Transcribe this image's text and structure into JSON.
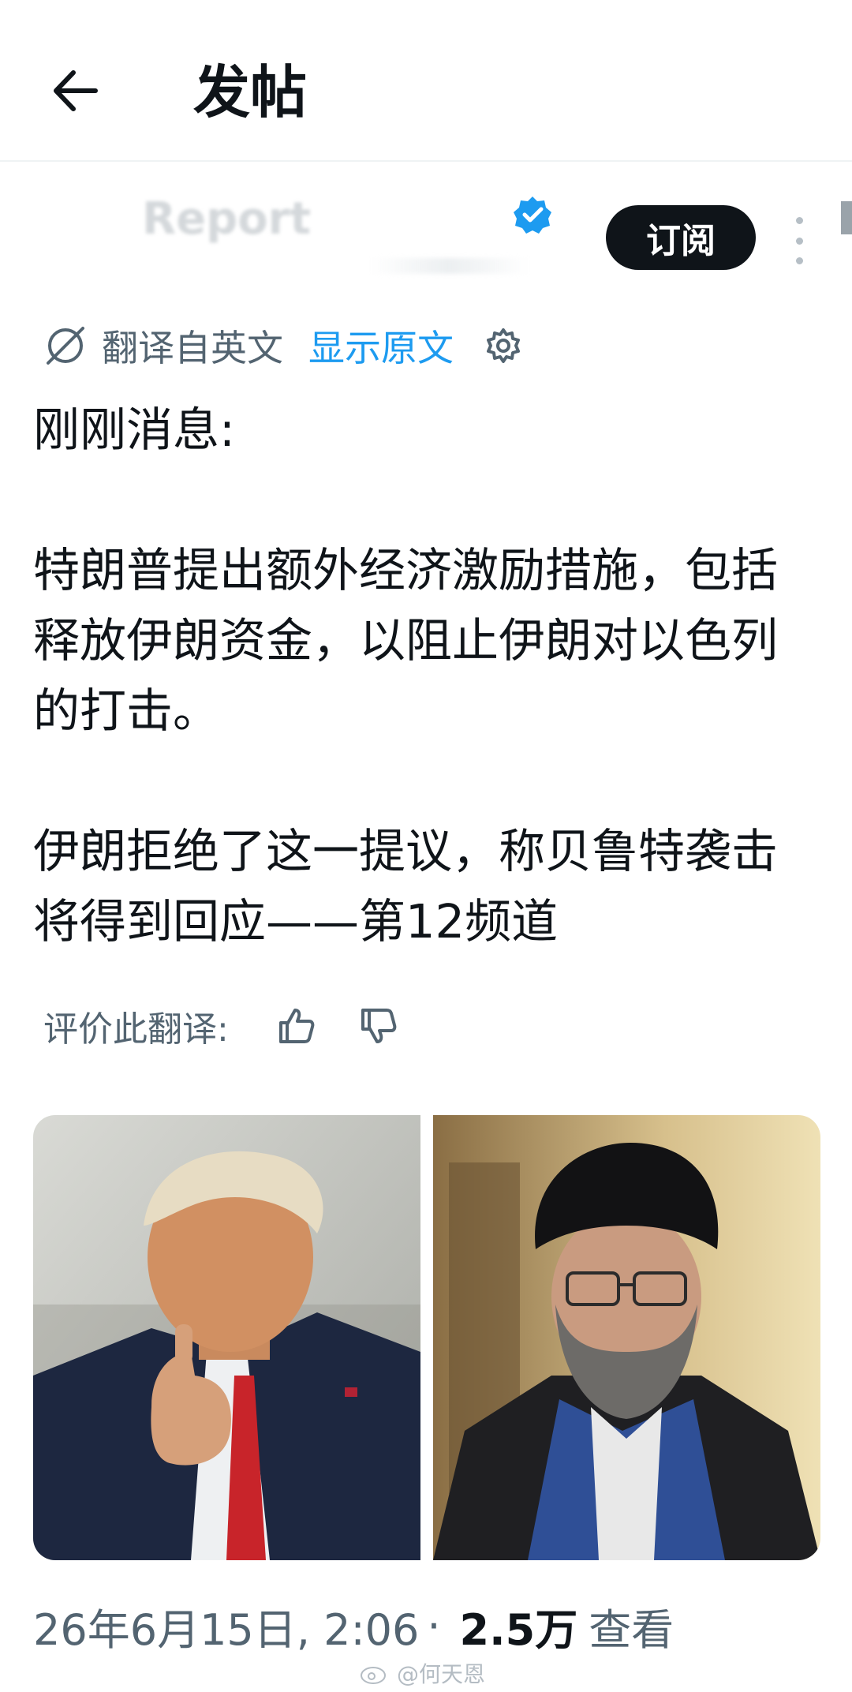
{
  "header": {
    "title": "发帖",
    "back_icon": "arrow-left-icon"
  },
  "author": {
    "name": "Report",
    "subscribe_label": "订阅",
    "verified_color": "#1d9bf0"
  },
  "translation": {
    "label": "翻译自英文",
    "show_original": "显示原文"
  },
  "post": {
    "line1": "刚刚消息:",
    "paragraph2": "特朗普提出额外经济激励措施，包括释放伊朗资金，以阻止伊朗对以色列的打击。",
    "paragraph3": "伊朗拒绝了这一提议，称贝鲁特袭击将得到回应——第12频道"
  },
  "rate": {
    "label": "评价此翻译:"
  },
  "meta": {
    "timestamp": "26年6月15日, 2:06",
    "separator": "·",
    "views_count": "2.5万",
    "views_label": "查看"
  },
  "watermark": {
    "text": "@何天恩"
  },
  "colors": {
    "accent": "#1d9bf0",
    "text_primary": "#0f1419",
    "text_secondary": "#536471"
  }
}
